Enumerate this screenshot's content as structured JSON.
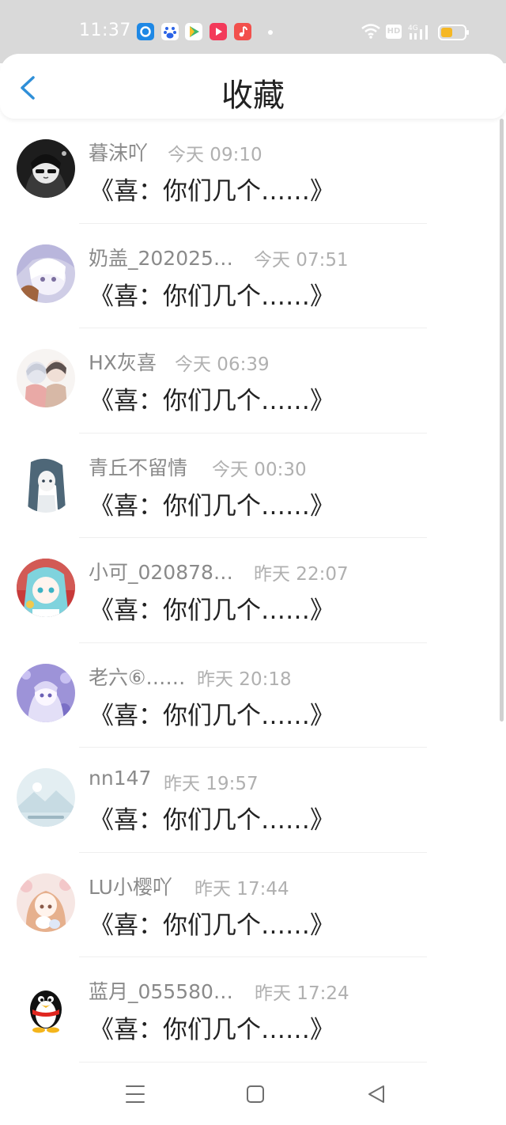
{
  "status_bar": {
    "time": "11:37",
    "app_icons": [
      {
        "name": "browser-app-icon",
        "color": "#1e88e5"
      },
      {
        "name": "baidu-app-icon",
        "color": "#2b63e6"
      },
      {
        "name": "play-app-icon",
        "color": "#41b86f"
      },
      {
        "name": "video-app-icon",
        "color": "#f33a5a"
      },
      {
        "name": "music-app-icon",
        "color": "#f2504c"
      }
    ],
    "hd_label": "HD",
    "network_label": "4G",
    "battery_color": "#f5b724"
  },
  "header": {
    "title": "收藏",
    "back_icon": "chevron-left-icon",
    "accent": "#2f8fd8"
  },
  "favorites": [
    {
      "name": "暮沫吖",
      "time": "今天 09:10",
      "preview": "《喜：你们几个……》",
      "avatar": "dark-portrait"
    },
    {
      "name": "奶盖_202025…",
      "time": "今天 07:51",
      "preview": "《喜：你们几个……》",
      "avatar": "white-hair-portrait"
    },
    {
      "name": "HX灰喜",
      "time": "今天 06:39",
      "preview": "《喜：你们几个……》",
      "avatar": "two-characters"
    },
    {
      "name": "青丘不留情",
      "time": "今天 00:30",
      "preview": "《喜：你们几个……》",
      "avatar": "sketch-girl"
    },
    {
      "name": "小可_020878…",
      "time": "昨天 22:07",
      "preview": "《喜：你们几个……》",
      "avatar": "teal-hair-girl"
    },
    {
      "name": "老六⑥……",
      "time": "昨天 20:18",
      "preview": "《喜：你们几个……》",
      "avatar": "purple-girl"
    },
    {
      "name": "nn147",
      "time": "昨天 19:57",
      "preview": "《喜：你们几个……》",
      "avatar": "placeholder-mountain"
    },
    {
      "name": "LU小樱吖",
      "time": "昨天 17:44",
      "preview": "《喜：你们几个……》",
      "avatar": "pink-girl"
    },
    {
      "name": "蓝月_055580…",
      "time": "昨天 17:24",
      "preview": "《喜：你们几个……》",
      "avatar": "qq-penguin"
    }
  ],
  "nav_bar": {
    "menu_icon": "menu-icon",
    "home_icon": "square-home-icon",
    "back_icon": "triangle-back-icon"
  }
}
